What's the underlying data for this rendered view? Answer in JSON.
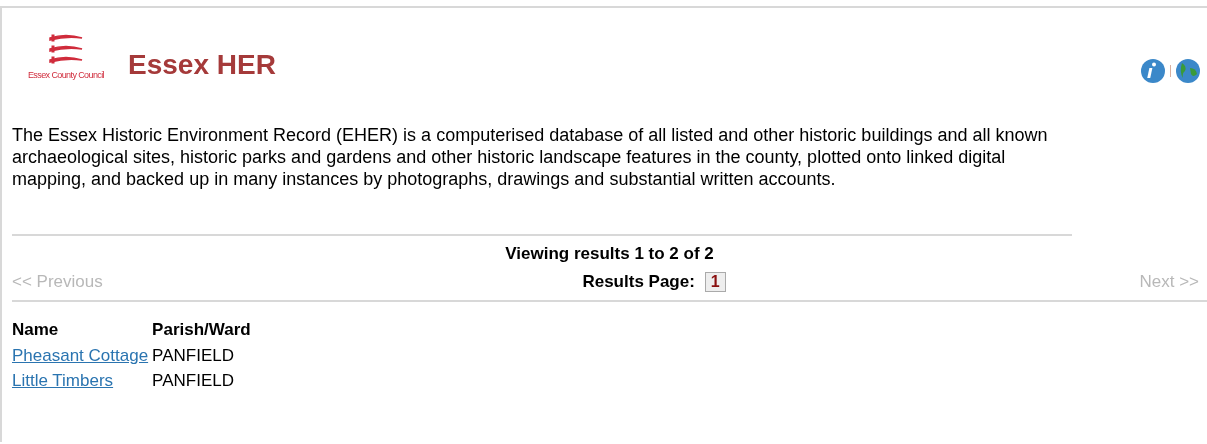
{
  "header": {
    "logo_text": "Essex County Council",
    "title": "Essex HER"
  },
  "description": "The Essex Historic Environment Record (EHER) is a computerised database of all listed and other historic buildings and all known archaeological sites, historic parks and gardens and other historic landscape features in the county, plotted onto linked digital mapping, and backed up in many instances by photographs, drawings and substantial written accounts.",
  "pagination": {
    "summary": "Viewing results 1 to 2 of 2",
    "previous": {
      "label": "<< Previous",
      "disabled": true
    },
    "next": {
      "label": "Next >>",
      "disabled": true
    },
    "pages_label": "Results Page:",
    "pages": [
      {
        "label": "1",
        "selected": true
      }
    ]
  },
  "table": {
    "columns": [
      "Name",
      "Parish/Ward"
    ],
    "rows": [
      {
        "name": "Pheasant Cottage",
        "parish": "PANFIELD"
      },
      {
        "name": "Little Timbers",
        "parish": "PANFIELD"
      }
    ]
  }
}
